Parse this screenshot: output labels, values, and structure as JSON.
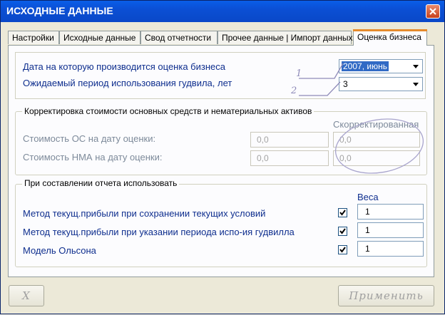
{
  "window": {
    "title": "ИСХОДНЫЕ ДАННЫЕ"
  },
  "tabs": [
    {
      "label": "Настройки",
      "active": false
    },
    {
      "label": "Исходные данные",
      "active": false
    },
    {
      "label": "Свод отчетности",
      "active": false
    },
    {
      "label": "Прочее данные | Импорт данных",
      "active": false
    },
    {
      "label": "Оценка бизнеса",
      "active": true
    }
  ],
  "valuation": {
    "date_label": "Дата на которую производится оценка бизнеса",
    "date_value": "2007, июнь",
    "goodwill_label": "Ожидаемый период использования гудвила, лет",
    "goodwill_value": "3",
    "annotation_1": "1",
    "annotation_2": "2"
  },
  "adjustment": {
    "title": "Корректировка стоимости основных средств и нематериальных активов",
    "adjusted_header": "Скорректированная",
    "os_label": "Стоимость ОС на дату оценки:",
    "os_value": "0,0",
    "os_adjusted": "0,0",
    "nma_label": "Стоимость НМА на дату оценки:",
    "nma_value": "0,0",
    "nma_adjusted": "0,0"
  },
  "report": {
    "title": "При составлении отчета использовать",
    "weights_header": "Веса",
    "methods": [
      {
        "label": "Метод текущ.прибыли при сохранении текущих условий",
        "checked": true,
        "weight": "1"
      },
      {
        "label": "Метод текущ.прибыли при указании периода испо-ия гудвилла",
        "checked": true,
        "weight": "1"
      },
      {
        "label": "Модель Ольсона",
        "checked": true,
        "weight": "1"
      }
    ]
  },
  "buttons": {
    "cancel": "X",
    "apply": "Применить"
  },
  "colors": {
    "titlebar": "#0b4fd4",
    "label_blue": "#0e2e8e",
    "annotation": "#8e8ab8",
    "selection": "#316ac5"
  }
}
